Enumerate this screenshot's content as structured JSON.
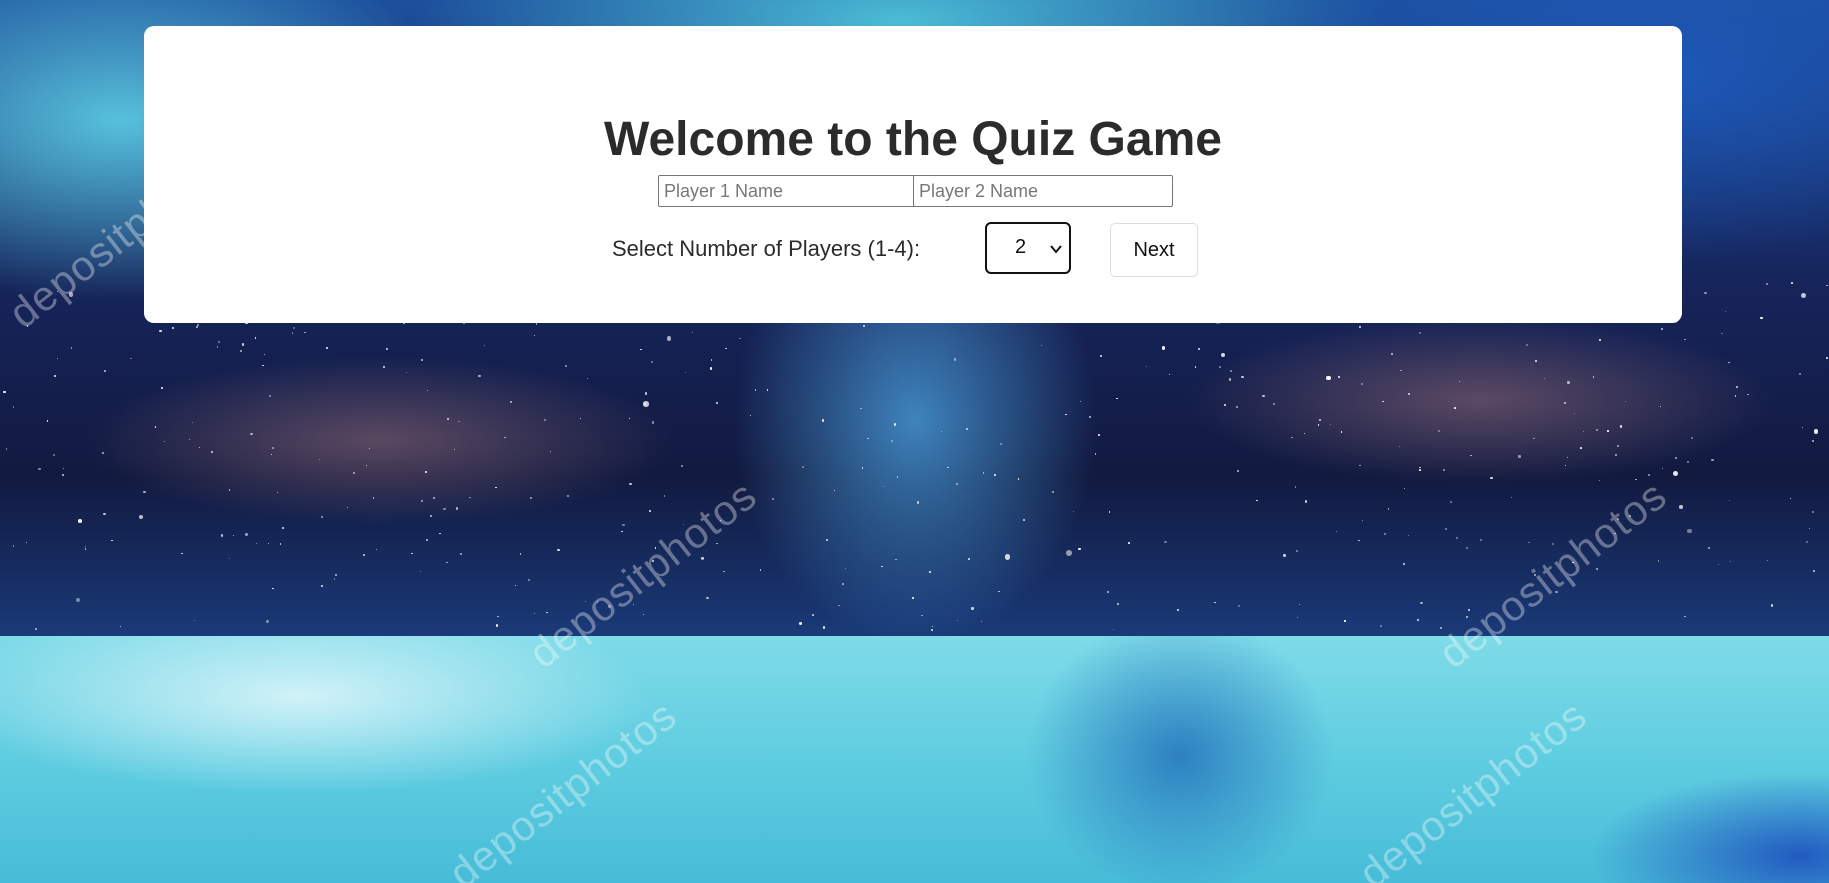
{
  "page": {
    "title": "Welcome to the Quiz Game"
  },
  "players": {
    "name_inputs": [
      {
        "placeholder": "Player 1 Name",
        "value": ""
      },
      {
        "placeholder": "Player 2 Name",
        "value": ""
      }
    ],
    "count_label": "Select Number of Players (1-4):",
    "count_selected": "2"
  },
  "actions": {
    "next_label": "Next"
  },
  "background": {
    "watermark_text": "depositphotos"
  },
  "colors": {
    "card": "#ffffff",
    "title": "#2b2b2b",
    "sky_dark": "#16245a",
    "water_light": "#5fcde0"
  }
}
